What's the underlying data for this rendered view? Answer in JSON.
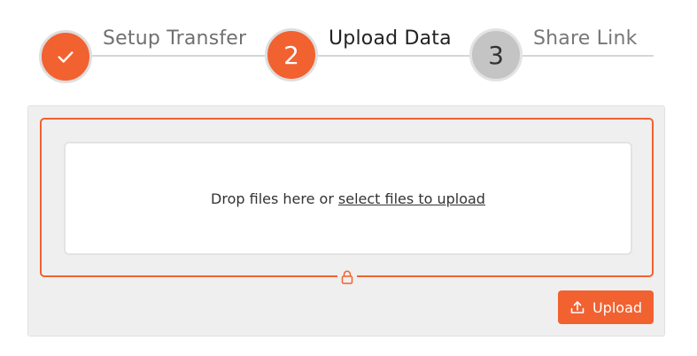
{
  "stepper": {
    "steps": [
      {
        "label": "Setup Transfer",
        "state": "completed",
        "number": "",
        "icon": "check-icon"
      },
      {
        "label": "Upload Data",
        "state": "active",
        "number": "2"
      },
      {
        "label": "Share Link",
        "state": "pending",
        "number": "3"
      }
    ]
  },
  "dropzone": {
    "prompt": "Drop files here or",
    "link": "select files to upload",
    "lock_icon": "lock-icon"
  },
  "actions": {
    "upload_label": "Upload",
    "upload_icon": "upload-icon"
  },
  "colors": {
    "accent": "#f26130",
    "pending_circle": "#c4c4c4",
    "panel_background": "#efefef",
    "dropzone_background": "#ffffff"
  }
}
